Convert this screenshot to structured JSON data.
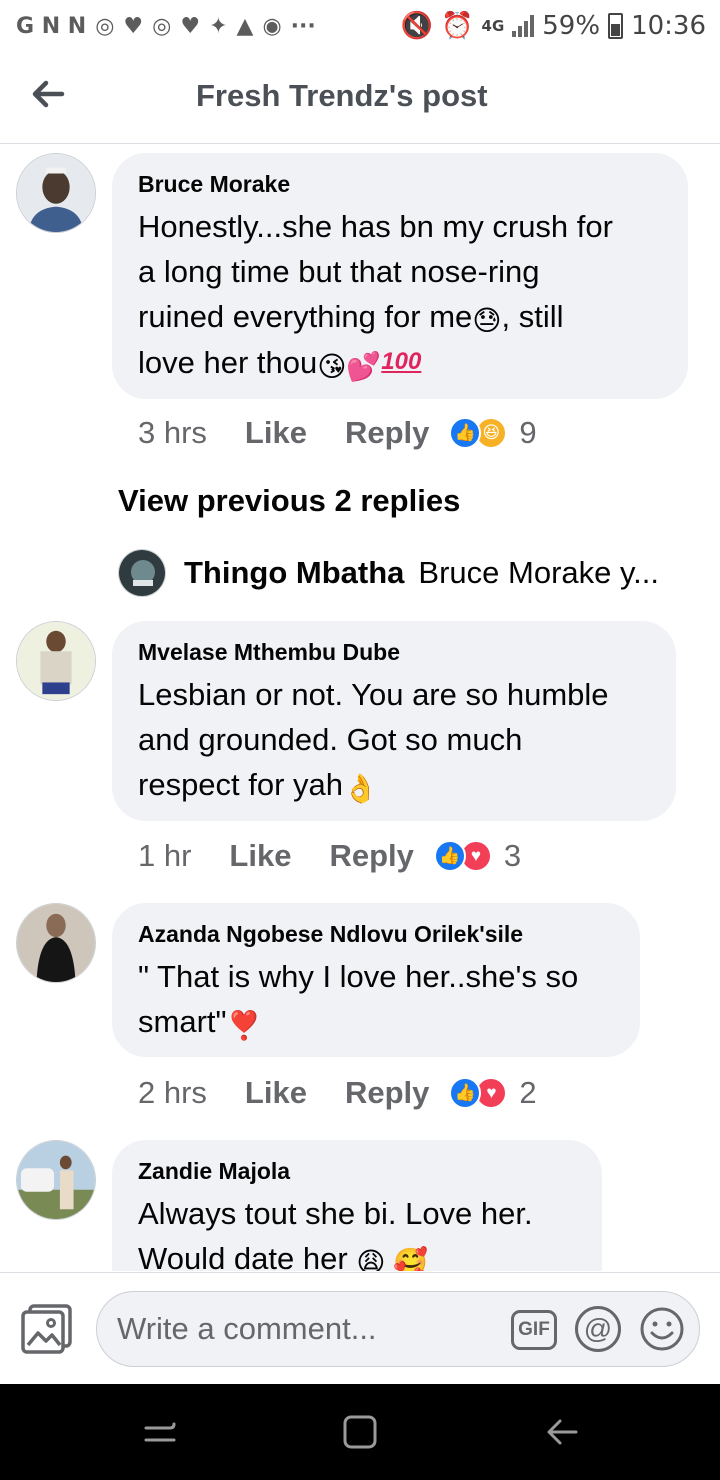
{
  "status_bar": {
    "left_text": "G N N",
    "indicators": [
      "wifi-calling",
      "heart",
      "wifi-calling",
      "heart",
      "twitter",
      "warning",
      "message",
      "more"
    ],
    "network": "4G",
    "battery": "59%",
    "time": "10:36"
  },
  "header": {
    "title": "Fresh Trendz's post",
    "back_icon": "arrow-left-icon"
  },
  "comments": [
    {
      "author": "Bruce Morake",
      "text": [
        "Honestly...she has bn my crush for",
        "a long time but that nose-ring",
        "ruined everything for me",
        ", still",
        "love her thou"
      ],
      "emoji_1": "😓",
      "emoji_2": "😘💕",
      "emoji_3": "100",
      "time": "3 hrs",
      "like": "Like",
      "reply": "Reply",
      "reactions": [
        "like",
        "haha"
      ],
      "reaction_count": "9"
    },
    {
      "author": "Mvelase Mthembu Dube",
      "text": [
        "Lesbian or not. You are so humble",
        "and grounded. Got so much",
        "respect for yah"
      ],
      "emoji_1": "👌",
      "time": "1 hr",
      "like": "Like",
      "reply": "Reply",
      "reactions": [
        "like",
        "love"
      ],
      "reaction_count": "3"
    },
    {
      "author": "Azanda Ngobese Ndlovu Orilek'sile",
      "text": [
        "\" That is why I love her..she's so",
        "smart\""
      ],
      "emoji_1": "❣️",
      "time": "2 hrs",
      "like": "Like",
      "reply": "Reply",
      "reactions": [
        "like",
        "love"
      ],
      "reaction_count": "2"
    },
    {
      "author": "Zandie Majola",
      "text": [
        "Always tout she bi. Love her.",
        "Would date her "
      ],
      "emoji_1": "😩 🥰"
    }
  ],
  "replies_thread": {
    "view_previous": "View previous 2 replies",
    "reply_author": "Thingo Mbatha",
    "reply_snippet": "Bruce Morake y..."
  },
  "composer": {
    "placeholder": "Write a comment...",
    "gif_label": "GIF",
    "at_label": "@"
  },
  "colors": {
    "bubble": "#f0f2f5",
    "secondary_text": "#65676b",
    "like_blue": "#1877f2",
    "love_red": "#f33e58",
    "haha_yellow": "#f7b125"
  }
}
